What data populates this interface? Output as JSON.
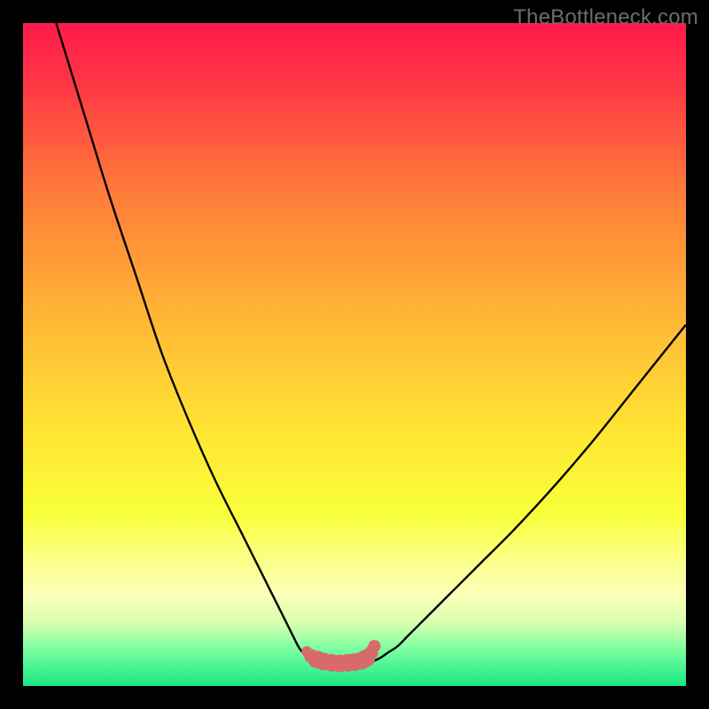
{
  "watermark": "TheBottleneck.com",
  "colors": {
    "black": "#000000",
    "curve": "#000000",
    "markers": "#d86a6a",
    "marker_stroke": "#c85a5a"
  },
  "chart_data": {
    "type": "line",
    "title": "",
    "xlabel": "",
    "ylabel": "",
    "xlim": [
      0,
      100
    ],
    "ylim": [
      0,
      100
    ],
    "background_gradient": [
      {
        "stop": 0.0,
        "color": "#ff1a4b"
      },
      {
        "stop": 0.1,
        "color": "#ff3a44"
      },
      {
        "stop": 0.25,
        "color": "#ff7a3a"
      },
      {
        "stop": 0.45,
        "color": "#ffb836"
      },
      {
        "stop": 0.62,
        "color": "#ffe633"
      },
      {
        "stop": 0.74,
        "color": "#f8ff3a"
      },
      {
        "stop": 0.81,
        "color": "#fbff87"
      },
      {
        "stop": 0.86,
        "color": "#fdffb8"
      },
      {
        "stop": 0.905,
        "color": "#d8ffb0"
      },
      {
        "stop": 0.945,
        "color": "#7affa0"
      },
      {
        "stop": 1.0,
        "color": "#18e884"
      }
    ],
    "series": [
      {
        "name": "left-curve",
        "type": "line",
        "x": [
          5,
          9,
          13,
          17,
          21,
          25,
          29,
          33,
          35,
          37,
          39,
          40.5,
          41.5,
          42.2,
          43
        ],
        "values": [
          100,
          87,
          74,
          62,
          50,
          40,
          31,
          23,
          19,
          15,
          11,
          8,
          6,
          5,
          4
        ]
      },
      {
        "name": "right-curve",
        "type": "line",
        "x": [
          53,
          54,
          55,
          56.5,
          58,
          60,
          62,
          65,
          69,
          74,
          80,
          86,
          92,
          98,
          100
        ],
        "values": [
          3.8,
          4.3,
          5,
          6,
          7.5,
          9.5,
          11.5,
          14.5,
          18.5,
          23.5,
          30,
          37,
          44.5,
          52,
          54.5
        ]
      },
      {
        "name": "valley-floor",
        "type": "line",
        "x": [
          43,
          44,
          46,
          48,
          50,
          51.5,
          52.5,
          53
        ],
        "values": [
          4,
          3.6,
          3.4,
          3.4,
          3.5,
          3.6,
          3.7,
          3.8
        ]
      },
      {
        "name": "valley-markers",
        "type": "scatter",
        "x": [
          42.8,
          43.5,
          44.3,
          45.3,
          46.5,
          47.8,
          49.0,
          50.0,
          51.0,
          51.8,
          52.5,
          53.0
        ],
        "values": [
          5.2,
          4.5,
          4.0,
          3.7,
          3.5,
          3.4,
          3.5,
          3.6,
          3.8,
          4.2,
          5.0,
          6.0
        ],
        "size": [
          6,
          8,
          10,
          10,
          10,
          10,
          10,
          10,
          10,
          10,
          8,
          7
        ]
      }
    ]
  }
}
